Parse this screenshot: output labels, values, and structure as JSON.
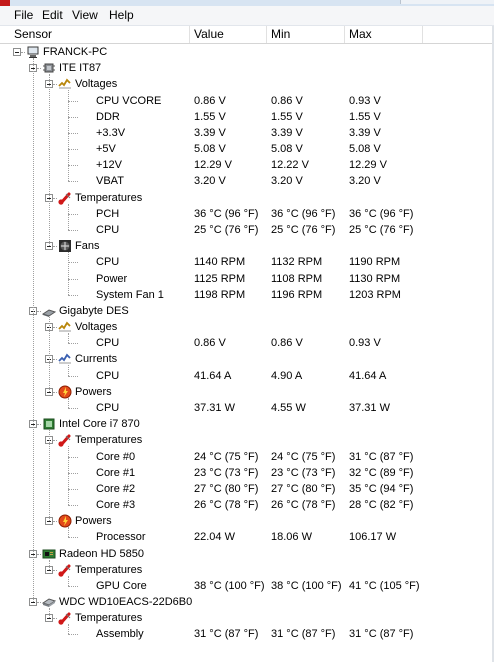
{
  "menu": [
    "File",
    "Edit",
    "View",
    "Help"
  ],
  "columns": [
    "Sensor",
    "Value",
    "Min",
    "Max"
  ],
  "tree": [
    {
      "level": 0,
      "type": "node",
      "icon": "computer-icon",
      "label": "FRANCK-PC"
    },
    {
      "level": 1,
      "type": "node",
      "icon": "chip-icon",
      "label": "ITE IT87"
    },
    {
      "level": 2,
      "type": "node",
      "icon": "voltage-icon",
      "label": "Voltages"
    },
    {
      "level": 3,
      "type": "leaf",
      "label": "CPU VCORE",
      "value": "0.86 V",
      "min": "0.86 V",
      "max": "0.93 V"
    },
    {
      "level": 3,
      "type": "leaf",
      "label": "DDR",
      "value": "1.55 V",
      "min": "1.55 V",
      "max": "1.55 V"
    },
    {
      "level": 3,
      "type": "leaf",
      "label": "+3.3V",
      "value": "3.39 V",
      "min": "3.39 V",
      "max": "3.39 V"
    },
    {
      "level": 3,
      "type": "leaf",
      "label": "+5V",
      "value": "5.08 V",
      "min": "5.08 V",
      "max": "5.08 V"
    },
    {
      "level": 3,
      "type": "leaf",
      "label": "+12V",
      "value": "12.29 V",
      "min": "12.22 V",
      "max": "12.29 V"
    },
    {
      "level": 3,
      "type": "leaf",
      "label": "VBAT",
      "value": "3.20 V",
      "min": "3.20 V",
      "max": "3.20 V"
    },
    {
      "level": 2,
      "type": "node",
      "icon": "thermometer-icon",
      "label": "Temperatures"
    },
    {
      "level": 3,
      "type": "leaf",
      "label": "PCH",
      "value": "36 °C  (96 °F)",
      "min": "36 °C  (96 °F)",
      "max": "36 °C  (96 °F)"
    },
    {
      "level": 3,
      "type": "leaf",
      "label": "CPU",
      "value": "25 °C  (76 °F)",
      "min": "25 °C  (76 °F)",
      "max": "25 °C  (76 °F)"
    },
    {
      "level": 2,
      "type": "node",
      "icon": "fan-icon",
      "label": "Fans"
    },
    {
      "level": 3,
      "type": "leaf",
      "label": "CPU",
      "value": "1140 RPM",
      "min": "1132 RPM",
      "max": "1190 RPM"
    },
    {
      "level": 3,
      "type": "leaf",
      "label": "Power",
      "value": "1125 RPM",
      "min": "1108 RPM",
      "max": "1130 RPM"
    },
    {
      "level": 3,
      "type": "leaf",
      "label": "System Fan 1",
      "value": "1198 RPM",
      "min": "1196 RPM",
      "max": "1203 RPM"
    },
    {
      "level": 1,
      "type": "node",
      "icon": "board-icon",
      "label": "Gigabyte DES"
    },
    {
      "level": 2,
      "type": "node",
      "icon": "voltage-icon",
      "label": "Voltages"
    },
    {
      "level": 3,
      "type": "leaf",
      "label": "CPU",
      "value": "0.86 V",
      "min": "0.86 V",
      "max": "0.93 V"
    },
    {
      "level": 2,
      "type": "node",
      "icon": "current-icon",
      "label": "Currents"
    },
    {
      "level": 3,
      "type": "leaf",
      "label": "CPU",
      "value": "41.64 A",
      "min": "4.90 A",
      "max": "41.64 A"
    },
    {
      "level": 2,
      "type": "node",
      "icon": "power-icon",
      "label": "Powers"
    },
    {
      "level": 3,
      "type": "leaf",
      "label": "CPU",
      "value": "37.31 W",
      "min": "4.55 W",
      "max": "37.31 W"
    },
    {
      "level": 1,
      "type": "node",
      "icon": "cpu-icon",
      "label": "Intel Core i7 870"
    },
    {
      "level": 2,
      "type": "node",
      "icon": "thermometer-icon",
      "label": "Temperatures"
    },
    {
      "level": 3,
      "type": "leaf",
      "label": "Core #0",
      "value": "24 °C  (75 °F)",
      "min": "24 °C  (75 °F)",
      "max": "31 °C  (87 °F)"
    },
    {
      "level": 3,
      "type": "leaf",
      "label": "Core #1",
      "value": "23 °C  (73 °F)",
      "min": "23 °C  (73 °F)",
      "max": "32 °C  (89 °F)"
    },
    {
      "level": 3,
      "type": "leaf",
      "label": "Core #2",
      "value": "27 °C  (80 °F)",
      "min": "27 °C  (80 °F)",
      "max": "35 °C  (94 °F)"
    },
    {
      "level": 3,
      "type": "leaf",
      "label": "Core #3",
      "value": "26 °C  (78 °F)",
      "min": "26 °C  (78 °F)",
      "max": "28 °C  (82 °F)"
    },
    {
      "level": 2,
      "type": "node",
      "icon": "power-icon",
      "label": "Powers"
    },
    {
      "level": 3,
      "type": "leaf",
      "label": "Processor",
      "value": "22.04 W",
      "min": "18.06 W",
      "max": "106.17 W"
    },
    {
      "level": 1,
      "type": "node",
      "icon": "gpu-icon",
      "label": "Radeon HD 5850"
    },
    {
      "level": 2,
      "type": "node",
      "icon": "thermometer-icon",
      "label": "Temperatures"
    },
    {
      "level": 3,
      "type": "leaf",
      "label": "GPU Core",
      "value": "38 °C  (100 °F)",
      "min": "38 °C  (100 °F)",
      "max": "41 °C  (105 °F)"
    },
    {
      "level": 1,
      "type": "node",
      "icon": "hdd-icon",
      "label": "WDC WD10EACS-22D6B0"
    },
    {
      "level": 2,
      "type": "node",
      "icon": "thermometer-icon",
      "label": "Temperatures"
    },
    {
      "level": 3,
      "type": "leaf",
      "label": "Assembly",
      "value": "31 °C  (87 °F)",
      "min": "31 °C  (87 °F)",
      "max": "31 °C  (87 °F)"
    }
  ]
}
